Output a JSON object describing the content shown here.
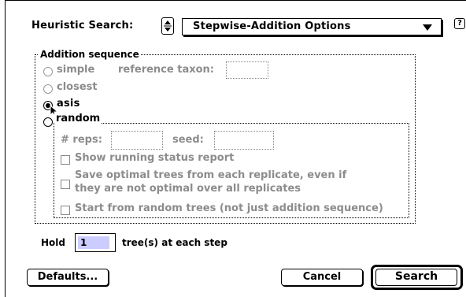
{
  "header": {
    "label": "Heuristic Search:",
    "popup_value": "Stepwise-Addition Options",
    "help_icon": "help-balloon-icon",
    "stepper_icon": "up-down-stepper-icon",
    "dropdown_icon": "triangle-down-icon"
  },
  "addition_sequence": {
    "title": "Addition sequence",
    "options": {
      "simple": "simple",
      "closest": "closest",
      "asis": "asis",
      "random": "random"
    },
    "reference_taxon_label": "reference taxon:",
    "reference_taxon_value": "",
    "selected": "asis"
  },
  "random_group": {
    "reps_label": "# reps:",
    "reps_value": "",
    "seed_label": "seed:",
    "seed_value": "",
    "show_status_label": "Show running status report",
    "save_optimal_label_line1": "Save optimal trees from each replicate, even if",
    "save_optimal_label_line2": "they are not optimal over all replicates",
    "start_random_label": "Start from random trees (not just addition sequence)"
  },
  "hold": {
    "label_before": "Hold",
    "value": "1",
    "label_after": "tree(s) at each step"
  },
  "buttons": {
    "defaults": "Defaults...",
    "cancel": "Cancel",
    "search": "Search"
  },
  "colors": {
    "disabled_text": "#8c8c8c",
    "input_highlight": "#ccccff"
  }
}
